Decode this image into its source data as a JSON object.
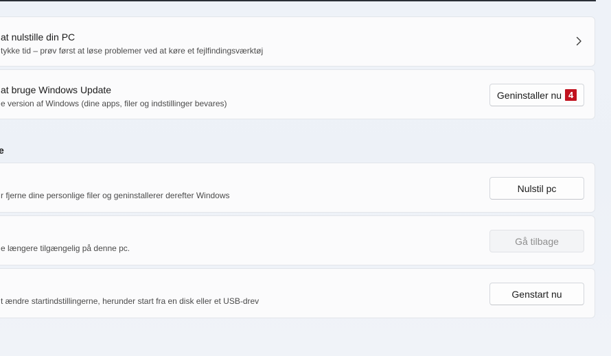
{
  "reset_help": {
    "title": "at nulstille din PC",
    "description": "tykke tid – prøv først at løse problemer ved at køre et fejlfindingsværktøj",
    "chevron_icon": "chevron-right-icon"
  },
  "windows_update": {
    "title": "at bruge Windows Update",
    "description": "e version af Windows (dine apps, filer og indstillinger bevares)",
    "button_label": "Geninstaller nu",
    "badge": "4"
  },
  "section": {
    "label": "e"
  },
  "reset_pc": {
    "description": "r fjerne dine personlige filer og geninstallerer derefter Windows",
    "button_label": "Nulstil pc"
  },
  "go_back": {
    "description": "e længere tilgængelig på denne pc.",
    "button_label": "Gå tilbage"
  },
  "advanced_startup": {
    "description": "t ændre startindstillingerne, herunder start fra en disk eller et USB-drev",
    "button_label": "Genstart nu"
  },
  "colors": {
    "badge": "#c1121f",
    "card": "#fbfbfc",
    "background": "#eef2f8"
  }
}
